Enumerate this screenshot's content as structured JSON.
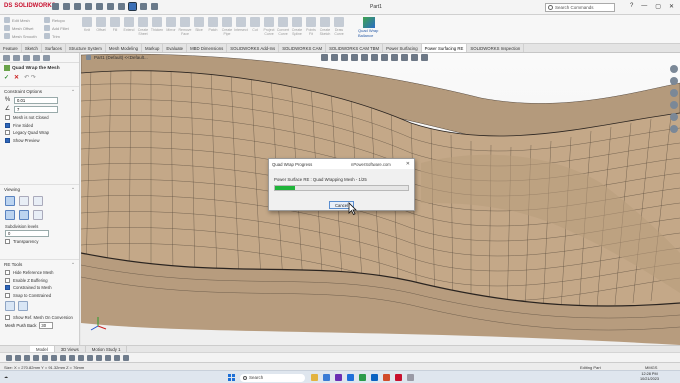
{
  "window": {
    "logo_text": "SOLIDWORKS",
    "doc_title": "Part1",
    "search_placeholder": "Search Commands",
    "controls": [
      "?",
      "—",
      "▢",
      "✕"
    ]
  },
  "ribbon": {
    "col1": [
      "Edit Mesh",
      "Mesh Offset",
      "Mesh Smooth"
    ],
    "col2": [
      "Retopo",
      "Add Fillet",
      "Trim"
    ],
    "big": [
      "Knit",
      "Offset",
      "Fill",
      "Extend",
      "Create Sheet",
      "Thicken",
      "Mirror",
      "Remove Face",
      "Slice",
      "Patch",
      "Create Pipe",
      "Intersect",
      "Cut",
      "Project Curve",
      "Convert Curve",
      "Create Spline",
      "Points Fit",
      "Create Sketch",
      "Draw Curve"
    ],
    "power_button": "Quad Wrap Ballance"
  },
  "command_tabs": [
    "Feature",
    "Sketch",
    "Surfaces",
    "Structure System",
    "Mesh Modeling",
    "Markup",
    "Evaluate",
    "MBD Dimensions",
    "SOLIDWORKS Add-Ins",
    "SOLIDWORKS CAM",
    "SOLIDWORKS CAM TBM",
    "Power Surfacing",
    "Power Surfacing RE",
    "SOLIDWORKS Inspection"
  ],
  "active_tab": "Power Surfacing RE",
  "panel": {
    "title": "Quad Wrap the Mesh",
    "ok": "✓",
    "cancel": "✕",
    "extras": "↶ ↷",
    "section_constraint": "Constraint Options",
    "field1_value": "0.01",
    "field2_value": "7",
    "checks": [
      {
        "label": "Mesh is not Closed",
        "on": false
      },
      {
        "label": "Fine Sided",
        "on": true
      },
      {
        "label": "Legacy Quad Wrap",
        "on": false
      },
      {
        "label": "Show Preview",
        "on": true
      }
    ],
    "section_viewing": "Viewing",
    "subdivision_label": "Subdivision levels",
    "subdivision_value": "0",
    "transparency_label": "Transparency",
    "section_tools": "RE Tools",
    "tool_checks": [
      {
        "label": "Hide Reference Mesh",
        "on": false
      },
      {
        "label": "Enable Z Buffering",
        "on": false
      },
      {
        "label": "Constrained to Mesh",
        "on": true
      },
      {
        "label": "Snap to Constrained",
        "on": false
      }
    ],
    "show_ref_label": "Show Ref. Mesh On Conversion",
    "mesh_push_label": "Mesh Push Back",
    "mesh_push_value": "30"
  },
  "viewport": {
    "breadcrumb": "Part1 (Default) <<Default..."
  },
  "dialog": {
    "title": "Quad Wrap Progress",
    "site": "nPowerSoftware.com",
    "message": "Power Surface RE : Quad Wrapping Mesh - 1/25",
    "progress": 0.15,
    "cancel_label": "Cancel",
    "close": "✕"
  },
  "model_tabs": [
    "Model",
    "3D Views",
    "Motion Study 1"
  ],
  "status": {
    "left": "Size: X = 270.82mm Y = 91.32mm Z = 76mm",
    "middle": "Editing Part",
    "right": "MMGS"
  },
  "taskbar": {
    "search": "Search",
    "time": "12:28 PM",
    "date": "10/21/2023",
    "app_colors": [
      "#e3b341",
      "#3a7bd5",
      "#6b2fb3",
      "#1e6fd9",
      "#2b9b4a",
      "#0b63c2",
      "#d14b2a",
      "#c8102e",
      "#9a9aa5"
    ]
  },
  "colors": {
    "surface": "#c4a888",
    "mesh_line": "#3a3028",
    "progress": "#1fb43a",
    "brand": "#c8102e"
  }
}
